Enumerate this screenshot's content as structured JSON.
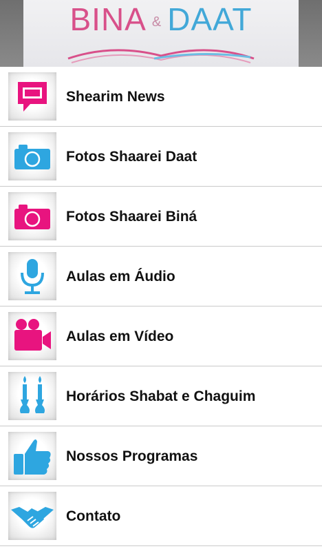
{
  "header": {
    "logo_left": "BINA",
    "logo_amp": "&",
    "logo_right": "DAAT"
  },
  "colors": {
    "pink": "#e8147f",
    "blue": "#2ea6e0",
    "text": "#111111",
    "divider": "#c9c9c9"
  },
  "menu": {
    "items": [
      {
        "label": "Shearim News",
        "icon": "chat-bubble-icon"
      },
      {
        "label": "Fotos Shaarei Daat",
        "icon": "camera-icon"
      },
      {
        "label": "Fotos Shaarei Biná",
        "icon": "camera-icon"
      },
      {
        "label": "Aulas em Áudio",
        "icon": "microphone-icon"
      },
      {
        "label": "Aulas em Vídeo",
        "icon": "video-camera-icon"
      },
      {
        "label": "Horários Shabat e Chaguim",
        "icon": "candles-icon"
      },
      {
        "label": "Nossos Programas",
        "icon": "thumbs-up-icon"
      },
      {
        "label": "Contato",
        "icon": "handshake-icon"
      }
    ]
  }
}
